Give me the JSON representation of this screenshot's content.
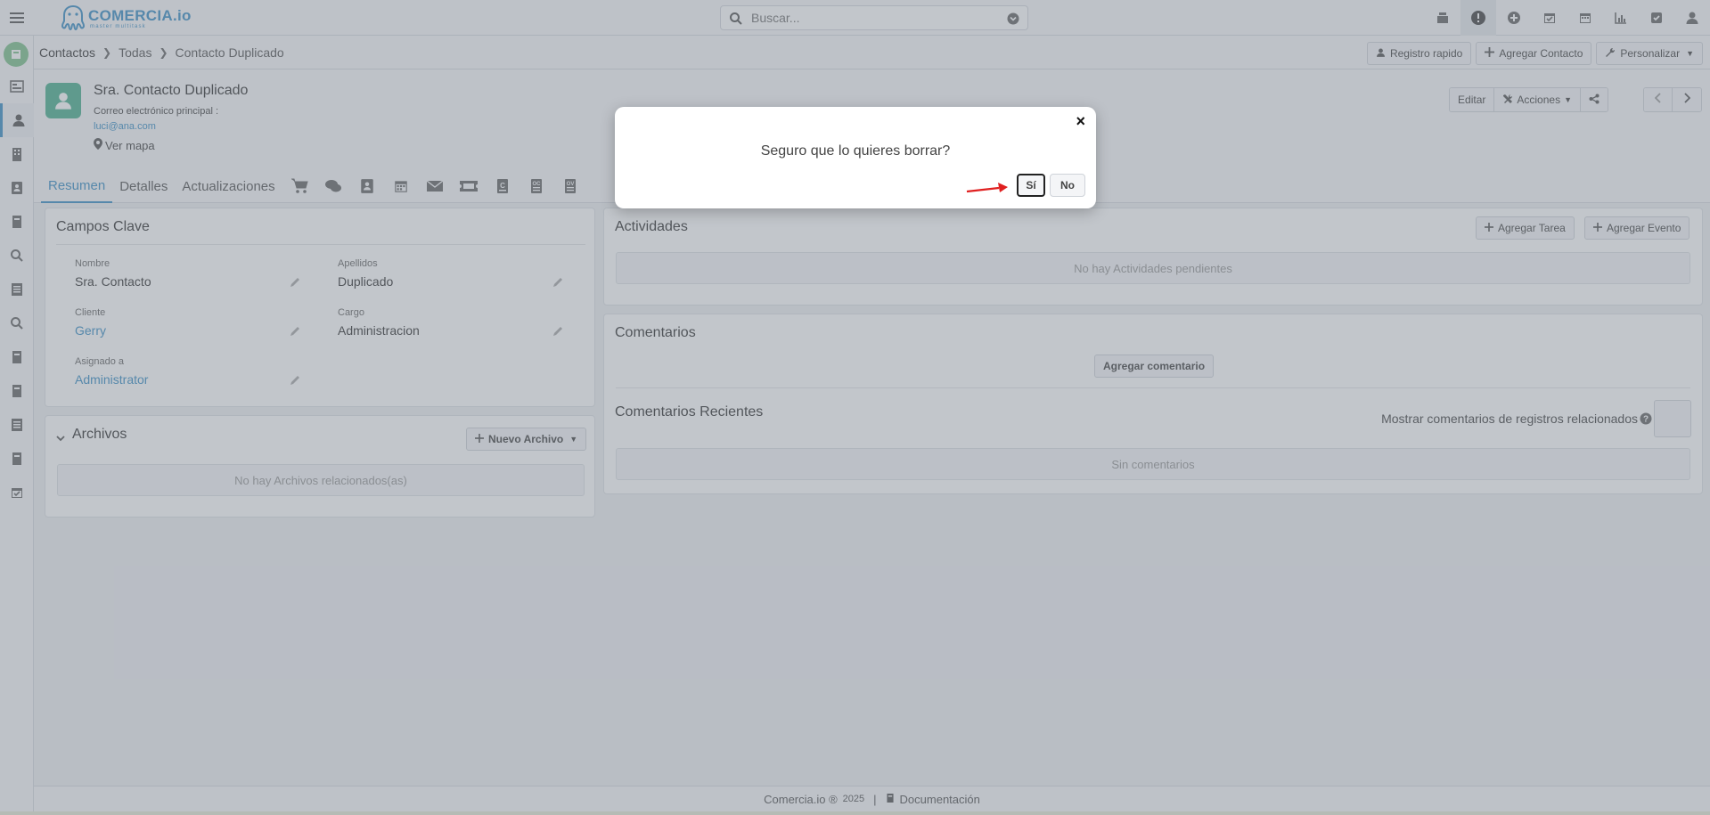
{
  "topbar": {
    "brand_name": "COMERCIA.io",
    "brand_tagline": "master multitask",
    "search_placeholder": "Buscar...",
    "icons": [
      "archive-icon",
      "alert-icon",
      "plus-circle-icon",
      "calendar-check-icon",
      "calendar-icon",
      "chart-icon",
      "checkbox-icon",
      "user-icon"
    ]
  },
  "sidebar": {
    "items": [
      "card-icon",
      "contacts-icon",
      "building-icon",
      "address-book-icon",
      "book-icon",
      "search-icon",
      "list-icon",
      "search-icon",
      "book-icon",
      "book-icon",
      "list-icon",
      "book-icon",
      "calendar-check-icon"
    ]
  },
  "breadcrumb": {
    "items": [
      "Contactos",
      "Todas",
      "Contacto Duplicado"
    ]
  },
  "header_actions": {
    "quick_register": "Registro rapido",
    "add_contact": "Agregar Contacto",
    "customize": "Personalizar"
  },
  "record": {
    "title": "Sra. Contacto Duplicado",
    "email_label": "Correo electrónico principal :",
    "email": "luci@ana.com",
    "map_link": "Ver mapa",
    "edit": "Editar",
    "actions": "Acciones"
  },
  "tabs": {
    "summary": "Resumen",
    "details": "Detalles",
    "updates": "Actualizaciones"
  },
  "key_fields": {
    "title": "Campos Clave",
    "first_name_label": "Nombre",
    "first_name": "Sra. Contacto",
    "last_name_label": "Apellidos",
    "last_name": "Duplicado",
    "client_label": "Cliente",
    "client": "Gerry",
    "role_label": "Cargo",
    "role": "Administracion",
    "assigned_label": "Asignado a",
    "assigned": "Administrator"
  },
  "files": {
    "title": "Archivos",
    "new_file": "Nuevo Archivo",
    "empty": "No hay Archivos relacionados(as)"
  },
  "activities": {
    "title": "Actividades",
    "add_task": "Agregar Tarea",
    "add_event": "Agregar Evento",
    "empty": "No hay Actividades pendientes"
  },
  "comments": {
    "title": "Comentarios",
    "add": "Agregar comentario",
    "recent_title": "Comentarios Recientes",
    "show_related": "Mostrar comentarios de registros relacionados",
    "empty": "Sin comentarios"
  },
  "footer": {
    "brand": "Comercia.io ®",
    "year": "2025",
    "separator": "|",
    "docs": "Documentación"
  },
  "dialog": {
    "message": "Seguro que lo quieres borrar?",
    "yes": "Sí",
    "no": "No",
    "close": "×"
  },
  "colors": {
    "accent": "#3b8fc5",
    "avatar": "#4caf8f",
    "annotation_arrow": "#e02020"
  }
}
